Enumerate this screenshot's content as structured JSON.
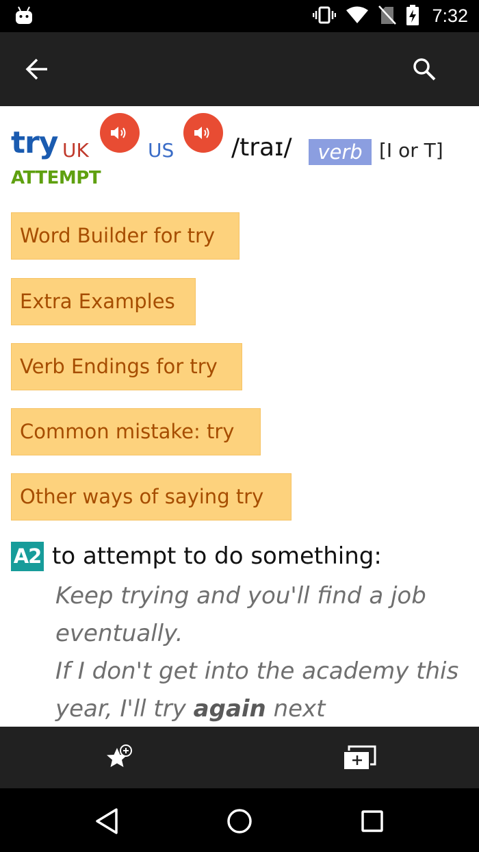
{
  "status_bar": {
    "time": "7:32",
    "icons": [
      "android-icon",
      "vibrate-icon",
      "wifi-icon",
      "no-sim-icon",
      "battery-charging-icon"
    ]
  },
  "app_bar": {
    "icons": [
      "back-arrow-icon",
      "search-icon"
    ]
  },
  "entry": {
    "headword": "try",
    "uk_label": "UK",
    "us_label": "US",
    "pronunciation": "/traɪ/",
    "part_of_speech": "verb",
    "grammar": "[I or T]",
    "guideword": "ATTEMPT",
    "speaker_color": "#e84c33"
  },
  "buttons": [
    {
      "label": "Word Builder for try"
    },
    {
      "label": "Extra Examples"
    },
    {
      "label": "Verb Endings for try"
    },
    {
      "label": "Common mistake: try"
    },
    {
      "label": "Other ways of saying try"
    }
  ],
  "sense": {
    "level": "A2",
    "definition": "to attempt to do something:",
    "examples": [
      {
        "text": "Keep trying and you'll find a job eventually."
      },
      {
        "before": "If I don't get into the academy this year, I'll try ",
        "bold": "again",
        "after": " next"
      }
    ]
  },
  "action_bar": {
    "icons": [
      "star-add-icon",
      "new-tab-icon"
    ]
  },
  "nav_bar": {
    "icons": [
      "nav-back-icon",
      "nav-home-icon",
      "nav-recent-icon"
    ]
  },
  "colors": {
    "app_bar": "#212121",
    "headword": "#1a5bb0",
    "guideword": "#5fa010",
    "button_bg": "#fdd27d",
    "button_text": "#a64d00",
    "pos_bg": "#8b9ee0",
    "level_bg": "#179c9a"
  }
}
